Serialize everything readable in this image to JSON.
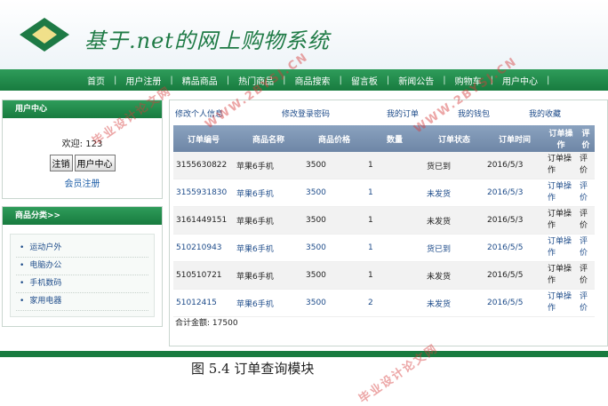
{
  "site": {
    "title": "基于.net的网上购物系统"
  },
  "nav": [
    "首页",
    "用户注册",
    "精品商品",
    "热门商品",
    "商品搜索",
    "留言板",
    "新闻公告",
    "购物车",
    "用户中心"
  ],
  "sidebar": {
    "user_panel": {
      "title": "用户中心",
      "welcome": "欢迎: 123",
      "logout_label": "注销",
      "center_label": "用户中心",
      "register_link": "会员注册"
    },
    "category_panel": {
      "title": "商品分类>>",
      "items": [
        "运动户外",
        "电脑办公",
        "手机数码",
        "家用电器"
      ]
    }
  },
  "sub_nav": [
    "修改个人信息",
    "修改登录密码",
    "我的订单",
    "我的钱包",
    "我的收藏"
  ],
  "orders": {
    "headers": [
      "订单编号",
      "商品名称",
      "商品价格",
      "数量",
      "订单状态",
      "订单时间",
      "订单操作",
      "评价"
    ],
    "rows": [
      {
        "id": "3155630822",
        "name": "苹果6手机",
        "price": "3500",
        "qty": "1",
        "status": "货已到",
        "time": "2016/5/3",
        "op": "订单操作",
        "review": "评价"
      },
      {
        "id": "3155931830",
        "name": "苹果6手机",
        "price": "3500",
        "qty": "1",
        "status": "未发货",
        "time": "2016/5/3",
        "op": "订单操作",
        "review": "评价"
      },
      {
        "id": "3161449151",
        "name": "苹果6手机",
        "price": "3500",
        "qty": "1",
        "status": "未发货",
        "time": "2016/5/3",
        "op": "订单操作",
        "review": "评价"
      },
      {
        "id": "510210943",
        "name": "苹果6手机",
        "price": "3500",
        "qty": "1",
        "status": "货已到",
        "time": "2016/5/5",
        "op": "订单操作",
        "review": "评价"
      },
      {
        "id": "510510721",
        "name": "苹果6手机",
        "price": "3500",
        "qty": "1",
        "status": "未发货",
        "time": "2016/5/5",
        "op": "订单操作",
        "review": "评价"
      },
      {
        "id": "51012415",
        "name": "苹果6手机",
        "price": "3500",
        "qty": "2",
        "status": "未发货",
        "time": "2016/5/5",
        "op": "订单操作",
        "review": "评价"
      }
    ],
    "total_label": "合计金额:",
    "total_value": "17500"
  },
  "caption": "图  5.4  订单查询模块",
  "watermarks": [
    "WWW.2BYSJ.CN",
    "毕业设计论文网",
    "WWW.2BYSJ.CN",
    "毕业设计论文网"
  ],
  "colors": {
    "brand_green": "#187b3f",
    "table_header": "#7890ae",
    "watermark": "#d63b3b"
  }
}
